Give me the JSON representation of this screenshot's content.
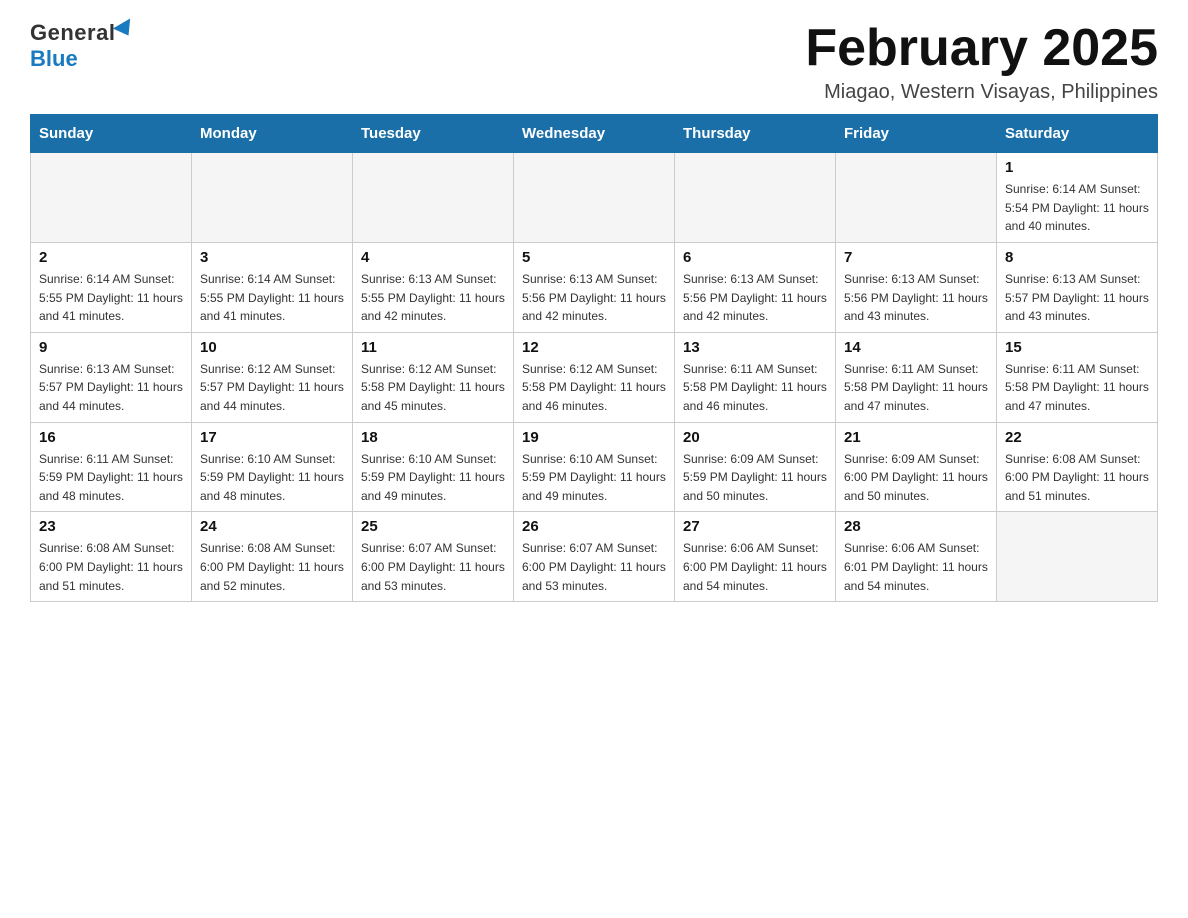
{
  "logo": {
    "general": "General",
    "blue": "Blue"
  },
  "title": "February 2025",
  "subtitle": "Miagao, Western Visayas, Philippines",
  "days_of_week": [
    "Sunday",
    "Monday",
    "Tuesday",
    "Wednesday",
    "Thursday",
    "Friday",
    "Saturday"
  ],
  "weeks": [
    [
      {
        "day": "",
        "info": ""
      },
      {
        "day": "",
        "info": ""
      },
      {
        "day": "",
        "info": ""
      },
      {
        "day": "",
        "info": ""
      },
      {
        "day": "",
        "info": ""
      },
      {
        "day": "",
        "info": ""
      },
      {
        "day": "1",
        "info": "Sunrise: 6:14 AM\nSunset: 5:54 PM\nDaylight: 11 hours and 40 minutes."
      }
    ],
    [
      {
        "day": "2",
        "info": "Sunrise: 6:14 AM\nSunset: 5:55 PM\nDaylight: 11 hours and 41 minutes."
      },
      {
        "day": "3",
        "info": "Sunrise: 6:14 AM\nSunset: 5:55 PM\nDaylight: 11 hours and 41 minutes."
      },
      {
        "day": "4",
        "info": "Sunrise: 6:13 AM\nSunset: 5:55 PM\nDaylight: 11 hours and 42 minutes."
      },
      {
        "day": "5",
        "info": "Sunrise: 6:13 AM\nSunset: 5:56 PM\nDaylight: 11 hours and 42 minutes."
      },
      {
        "day": "6",
        "info": "Sunrise: 6:13 AM\nSunset: 5:56 PM\nDaylight: 11 hours and 42 minutes."
      },
      {
        "day": "7",
        "info": "Sunrise: 6:13 AM\nSunset: 5:56 PM\nDaylight: 11 hours and 43 minutes."
      },
      {
        "day": "8",
        "info": "Sunrise: 6:13 AM\nSunset: 5:57 PM\nDaylight: 11 hours and 43 minutes."
      }
    ],
    [
      {
        "day": "9",
        "info": "Sunrise: 6:13 AM\nSunset: 5:57 PM\nDaylight: 11 hours and 44 minutes."
      },
      {
        "day": "10",
        "info": "Sunrise: 6:12 AM\nSunset: 5:57 PM\nDaylight: 11 hours and 44 minutes."
      },
      {
        "day": "11",
        "info": "Sunrise: 6:12 AM\nSunset: 5:58 PM\nDaylight: 11 hours and 45 minutes."
      },
      {
        "day": "12",
        "info": "Sunrise: 6:12 AM\nSunset: 5:58 PM\nDaylight: 11 hours and 46 minutes."
      },
      {
        "day": "13",
        "info": "Sunrise: 6:11 AM\nSunset: 5:58 PM\nDaylight: 11 hours and 46 minutes."
      },
      {
        "day": "14",
        "info": "Sunrise: 6:11 AM\nSunset: 5:58 PM\nDaylight: 11 hours and 47 minutes."
      },
      {
        "day": "15",
        "info": "Sunrise: 6:11 AM\nSunset: 5:58 PM\nDaylight: 11 hours and 47 minutes."
      }
    ],
    [
      {
        "day": "16",
        "info": "Sunrise: 6:11 AM\nSunset: 5:59 PM\nDaylight: 11 hours and 48 minutes."
      },
      {
        "day": "17",
        "info": "Sunrise: 6:10 AM\nSunset: 5:59 PM\nDaylight: 11 hours and 48 minutes."
      },
      {
        "day": "18",
        "info": "Sunrise: 6:10 AM\nSunset: 5:59 PM\nDaylight: 11 hours and 49 minutes."
      },
      {
        "day": "19",
        "info": "Sunrise: 6:10 AM\nSunset: 5:59 PM\nDaylight: 11 hours and 49 minutes."
      },
      {
        "day": "20",
        "info": "Sunrise: 6:09 AM\nSunset: 5:59 PM\nDaylight: 11 hours and 50 minutes."
      },
      {
        "day": "21",
        "info": "Sunrise: 6:09 AM\nSunset: 6:00 PM\nDaylight: 11 hours and 50 minutes."
      },
      {
        "day": "22",
        "info": "Sunrise: 6:08 AM\nSunset: 6:00 PM\nDaylight: 11 hours and 51 minutes."
      }
    ],
    [
      {
        "day": "23",
        "info": "Sunrise: 6:08 AM\nSunset: 6:00 PM\nDaylight: 11 hours and 51 minutes."
      },
      {
        "day": "24",
        "info": "Sunrise: 6:08 AM\nSunset: 6:00 PM\nDaylight: 11 hours and 52 minutes."
      },
      {
        "day": "25",
        "info": "Sunrise: 6:07 AM\nSunset: 6:00 PM\nDaylight: 11 hours and 53 minutes."
      },
      {
        "day": "26",
        "info": "Sunrise: 6:07 AM\nSunset: 6:00 PM\nDaylight: 11 hours and 53 minutes."
      },
      {
        "day": "27",
        "info": "Sunrise: 6:06 AM\nSunset: 6:00 PM\nDaylight: 11 hours and 54 minutes."
      },
      {
        "day": "28",
        "info": "Sunrise: 6:06 AM\nSunset: 6:01 PM\nDaylight: 11 hours and 54 minutes."
      },
      {
        "day": "",
        "info": ""
      }
    ]
  ]
}
